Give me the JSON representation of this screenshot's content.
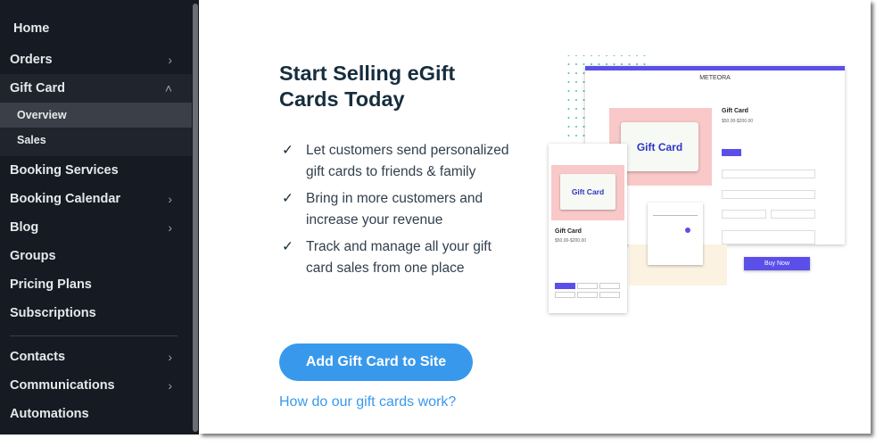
{
  "sidebar": {
    "items": [
      {
        "label": "Home",
        "chevron": ""
      },
      {
        "label": "Orders",
        "chevron": "›"
      },
      {
        "label": "Gift Card",
        "chevron": "˄"
      },
      {
        "label": "Overview",
        "chevron": ""
      },
      {
        "label": "Sales",
        "chevron": ""
      },
      {
        "label": "Booking Services",
        "chevron": ""
      },
      {
        "label": "Booking Calendar",
        "chevron": "›"
      },
      {
        "label": "Blog",
        "chevron": "›"
      },
      {
        "label": "Groups",
        "chevron": ""
      },
      {
        "label": "Pricing Plans",
        "chevron": ""
      },
      {
        "label": "Subscriptions",
        "chevron": ""
      },
      {
        "label": "Contacts",
        "chevron": "›"
      },
      {
        "label": "Communications",
        "chevron": "›"
      },
      {
        "label": "Automations",
        "chevron": ""
      }
    ]
  },
  "main": {
    "title": "Start Selling eGift Cards Today",
    "bullets": [
      "Let customers send personalized gift cards to friends & family",
      "Bring in more customers and increase your revenue",
      "Track and manage all your gift card sales from one place"
    ],
    "cta": "Add Gift Card to Site",
    "link": "How do our gift cards work?"
  },
  "illustration": {
    "brand": "METEORA",
    "card_text": "Gift Card",
    "product_title": "Gift Card",
    "price": "$50.00-$200.00",
    "buy": "Buy Now",
    "accent": "#5b4fe9"
  },
  "colors": {
    "sidebar_bg": "#151a23",
    "accent": "#3899ec",
    "title": "#162d3d"
  }
}
